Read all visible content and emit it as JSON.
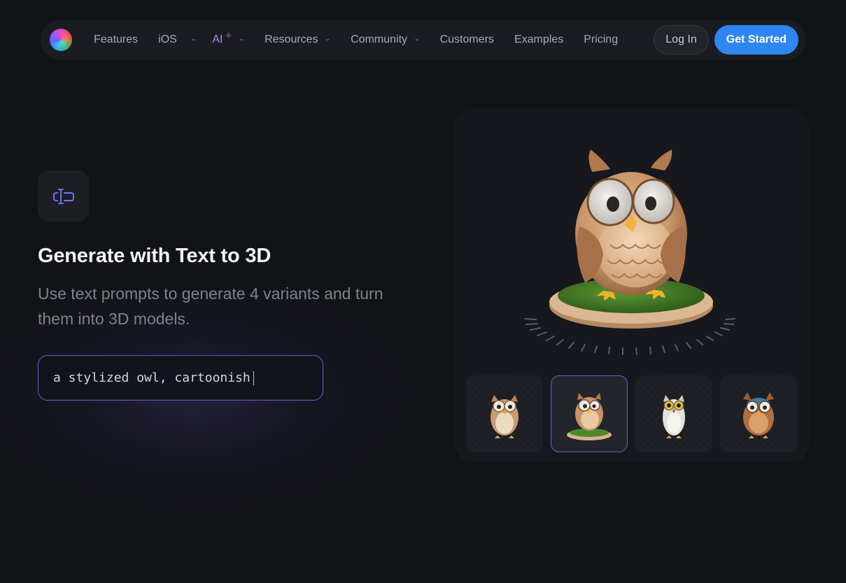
{
  "nav": {
    "items": [
      {
        "label": "Features",
        "has_dropdown": false
      },
      {
        "label": "iOS",
        "has_dropdown": true
      },
      {
        "label": "AI",
        "has_dropdown": true,
        "badge_icon": "sparkle-icon",
        "accent": "#a88cff"
      },
      {
        "label": "Resources",
        "has_dropdown": true
      },
      {
        "label": "Community",
        "has_dropdown": true
      },
      {
        "label": "Customers",
        "has_dropdown": false
      },
      {
        "label": "Examples",
        "has_dropdown": false
      },
      {
        "label": "Pricing",
        "has_dropdown": false
      }
    ],
    "login_label": "Log In",
    "cta_label": "Get Started",
    "cta_color": "#2f86f3"
  },
  "feature": {
    "icon": "text-cursor-icon",
    "heading": "Generate with Text to 3D",
    "subtext": "Use text prompts to generate 4 variants and turn them into 3D models.",
    "prompt_value": "a stylized owl, cartoonish"
  },
  "viewer": {
    "preview": "owl-3d-model",
    "variants": [
      {
        "name": "owl-variant-1",
        "selected": false
      },
      {
        "name": "owl-variant-2",
        "selected": true
      },
      {
        "name": "owl-variant-3",
        "selected": false
      },
      {
        "name": "owl-variant-4",
        "selected": false
      }
    ],
    "accent_color": "#5c62d6"
  }
}
